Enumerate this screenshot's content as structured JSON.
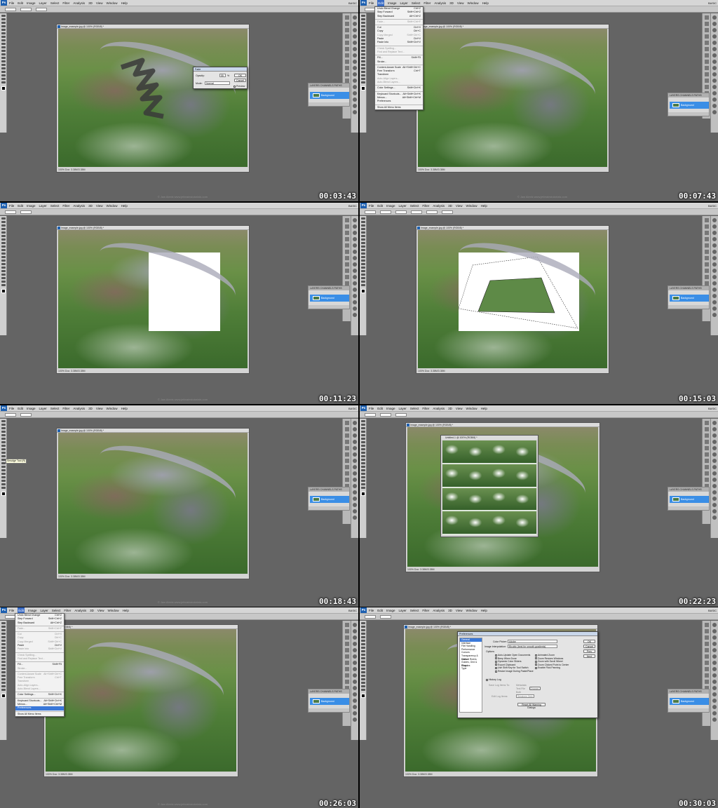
{
  "menu_items": [
    "File",
    "Edit",
    "Image",
    "Layer",
    "Select",
    "Filter",
    "Analysis",
    "3D",
    "View",
    "Window",
    "Help"
  ],
  "workspace": "BASIC",
  "doc_title": "Image_example.jpg @ 100% (RGB/8) *",
  "doc_title_short": "ud @ 100% (RGB/8) *",
  "untitled_title": "Untitled-1 @ 100% (RGB/8) *",
  "status_text": "100%    Doc: 3.38M/3.38M",
  "layers": {
    "tabs": "LAYERS  CHANNELS  PATHS",
    "layer_name": "Background"
  },
  "watermark": "© Jaw Alexis  www.jetbrainstutorials.com",
  "timecodes": [
    "00:03:43",
    "00:07:43",
    "00:11:23",
    "00:15:03",
    "00:18:43",
    "00:22:23",
    "00:26:03",
    "00:30:03"
  ],
  "fade_dialog": {
    "title": "Fade",
    "opacity_label": "Opacity:",
    "opacity_value": "55",
    "pct": "%",
    "mode_label": "Mode:",
    "mode_value": "Normal",
    "ok": "OK",
    "cancel": "Cancel",
    "preview": "Preview"
  },
  "edit_menu": [
    {
      "label": "Undo Blend Change",
      "shortcut": "Ctrl+Z"
    },
    {
      "label": "Step Forward",
      "shortcut": "Shift+Ctrl+Z"
    },
    {
      "label": "Step Backward",
      "shortcut": "Alt+Ctrl+Z"
    },
    {
      "label": "Fade...",
      "shortcut": "Shift+Ctrl+F"
    },
    {
      "label": "Cut",
      "shortcut": "Ctrl+X"
    },
    {
      "label": "Copy",
      "shortcut": "Ctrl+C"
    },
    {
      "label": "Copy Merged",
      "shortcut": "Shift+Ctrl+C"
    },
    {
      "label": "Paste",
      "shortcut": "Ctrl+V"
    },
    {
      "label": "Paste Into",
      "shortcut": "Shift+Ctrl+V"
    },
    {
      "label": "Clear",
      "shortcut": ""
    },
    {
      "label": "Check Spelling...",
      "shortcut": ""
    },
    {
      "label": "Find and Replace Text...",
      "shortcut": ""
    },
    {
      "label": "Fill...",
      "shortcut": "Shift+F5"
    },
    {
      "label": "Stroke...",
      "shortcut": ""
    },
    {
      "label": "Content-Aware Scale",
      "shortcut": "Alt+Shift+Ctrl+C"
    },
    {
      "label": "Free Transform",
      "shortcut": "Ctrl+T"
    },
    {
      "label": "Transform",
      "shortcut": ""
    },
    {
      "label": "Auto-Align Layers...",
      "shortcut": ""
    },
    {
      "label": "Auto-Blend Layers...",
      "shortcut": ""
    },
    {
      "label": "Color Settings...",
      "shortcut": "Shift+Ctrl+K"
    },
    {
      "label": "Keyboard Shortcuts...",
      "shortcut": "Alt+Shift+Ctrl+K"
    },
    {
      "label": "Menus...",
      "shortcut": "Alt+Shift+Ctrl+M"
    },
    {
      "label": "Preferences",
      "shortcut": ""
    },
    {
      "label": "Show All Menu Items",
      "shortcut": ""
    }
  ],
  "tooltip": "Smudge Tool (R)",
  "prefs": {
    "title": "Preferences",
    "sections": [
      "General",
      "Interface",
      "File Handling",
      "Performance",
      "Cursors",
      "Transparency & Gamut",
      "Units & Rulers",
      "Guides, Grid & Slices",
      "Plug-Ins",
      "Type"
    ],
    "color_picker_label": "Color Picker:",
    "color_picker_value": "Adobe",
    "interp_label": "Image Interpolation:",
    "interp_value": "Bicubic (best for smooth gradients)",
    "options_label": "Options",
    "options_left": [
      "Auto-Update Open Documents",
      "Beep When Done",
      "Dynamic Color Sliders",
      "Export Clipboard",
      "Use Shift Key for Tool Switch",
      "Resize Image During Paste/Place"
    ],
    "options_right": [
      "Animated Zoom",
      "Zoom Resizes Windows",
      "Zoom with Scroll Wheel",
      "Zoom Clicked Point to Center",
      "Enable Flick Panning"
    ],
    "history_log": "History Log",
    "save_log_label": "Save Log Items To:",
    "metadata": "Metadata",
    "text_file": "Text File",
    "both": "Both",
    "choose": "Choose...",
    "edit_log_label": "Edit Log Items:",
    "edit_log_value": "Sessions Only",
    "reset_warnings": "Reset All Warning Dialogs",
    "buttons": [
      "OK",
      "Cancel",
      "Prev",
      "Next"
    ]
  }
}
